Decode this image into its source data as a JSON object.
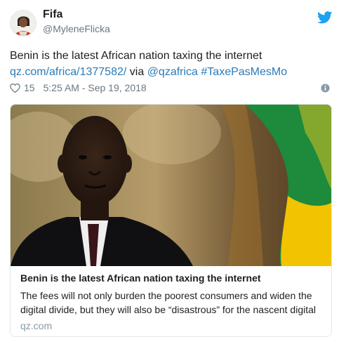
{
  "author": {
    "name": "Fifa",
    "handle": "@MyleneFlicka"
  },
  "tweet": {
    "text": "Benin is the latest African nation taxing the internet",
    "link": "qz.com/africa/1377582/",
    "via": "via",
    "mention": "@qzafrica",
    "hashtag": "#TaxePasMesMo",
    "likes": "15",
    "timestamp": "5:25 AM - Sep 19, 2018"
  },
  "card": {
    "title": "Benin is the latest African nation taxing the internet",
    "description": "The fees will not only burden the poorest consumers and widen the digital divide, but they will also be “disastrous” for the nascent digital",
    "domain": "qz.com"
  },
  "icons": {
    "brand": "twitter-bird-icon",
    "like": "heart-icon",
    "info": "info-icon"
  },
  "colors": {
    "link": "#2b7bb9",
    "brand": "#1da1f2",
    "secondary_text": "#697882",
    "border": "#e1e8ed",
    "flag_green": "#1f8a3b",
    "flag_yellow": "#f5c400",
    "flag_red": "#d32f2f"
  }
}
